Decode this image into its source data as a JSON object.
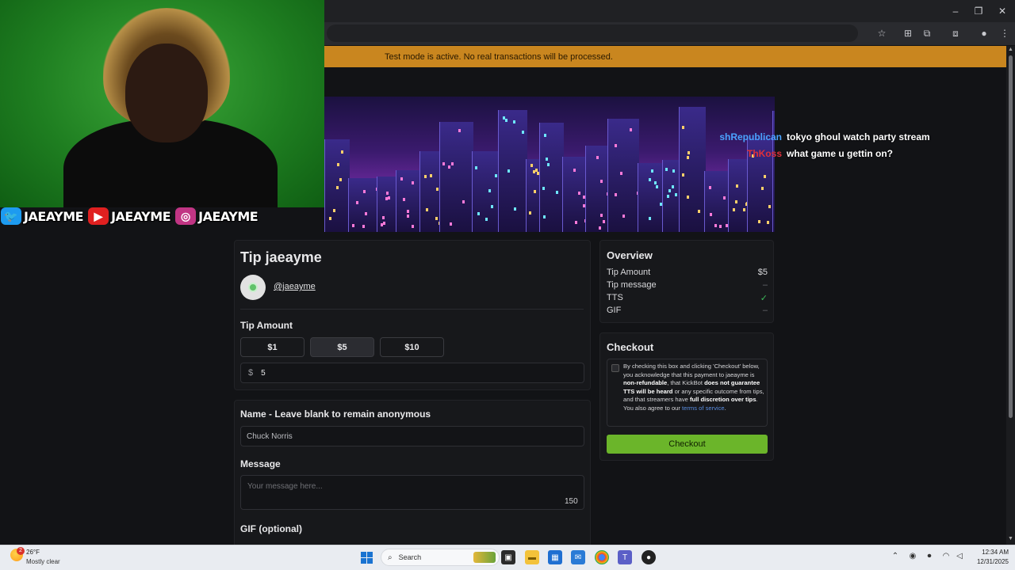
{
  "banner": {
    "text": "Test mode is active. No real transactions will be processed."
  },
  "window_controls": {
    "minimize": "–",
    "restore": "❐",
    "close": "✕"
  },
  "toolbar_icons": [
    "☆",
    "⊞",
    "⧉",
    "⧈",
    "●",
    "⋮"
  ],
  "socials": [
    {
      "icon": "twitter-icon",
      "glyph": "🐦",
      "color": "#1d9bf0",
      "name": "JAEAYME"
    },
    {
      "icon": "youtube-icon",
      "glyph": "▶",
      "color": "#e02020",
      "name": "JAEAYME"
    },
    {
      "icon": "instagram-icon",
      "glyph": "◎",
      "color": "#c13584",
      "name": "JAEAYME"
    }
  ],
  "chat": [
    {
      "user": "shRepublican",
      "user_color": "#4aa3ff",
      "message": "tokyo ghoul watch party stream"
    },
    {
      "user": "ThKoss",
      "user_color": "#e0303a",
      "message": "what game u gettin on?"
    }
  ],
  "tip": {
    "title": "Tip jaeayme",
    "handle": "@jaeayme",
    "amount_label": "Tip Amount",
    "amount_options": [
      "$1",
      "$5",
      "$10"
    ],
    "selected_amount": "$5",
    "currency_symbol": "$",
    "amount_value": "5"
  },
  "form": {
    "name_label": "Name - Leave blank to remain anonymous",
    "name_value": "Chuck Norris",
    "message_label": "Message",
    "message_placeholder": "Your message here...",
    "message_remaining": "150",
    "gif_label": "GIF (optional)"
  },
  "overview": {
    "title": "Overview",
    "rows": [
      {
        "label": "Tip Amount",
        "value": "$5",
        "style": "normal"
      },
      {
        "label": "Tip message",
        "value": "–",
        "style": "dim"
      },
      {
        "label": "TTS",
        "value": "✓",
        "style": "check"
      },
      {
        "label": "GIF",
        "value": "–",
        "style": "dim"
      }
    ]
  },
  "checkout": {
    "title": "Checkout",
    "consent_part1": "By checking this box and clicking 'Checkout' below, you acknowledge that this payment to jaeayme is ",
    "consent_bold1": "non-refundable",
    "consent_part2": ", that KickBot ",
    "consent_bold2": "does not guarantee TTS will be heard",
    "consent_part3": " or any specific outcome from tips, and that streamers have ",
    "consent_bold3": "full discretion over tips",
    "consent_part4": ". You also agree to our ",
    "consent_link": "terms of service",
    "consent_end": ".",
    "button_label": "Checkout"
  },
  "taskbar": {
    "weather_badge": "2",
    "weather_temp": "26°F",
    "weather_desc": "Mostly clear",
    "search_label": "Search",
    "clock_time": "12:34 AM",
    "clock_date": "12/31/2025"
  }
}
